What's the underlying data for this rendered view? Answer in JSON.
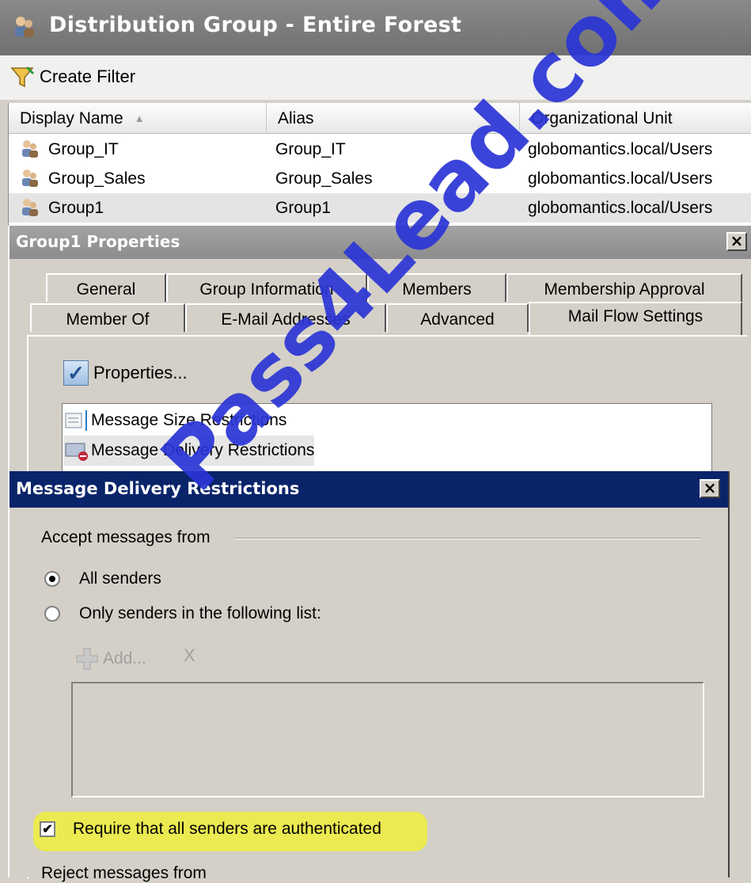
{
  "window": {
    "title": "Distribution Group - Entire Forest",
    "icon": "group-icon"
  },
  "toolbar": {
    "create_filter_label": "Create Filter",
    "icon": "filter-icon"
  },
  "grid": {
    "columns": [
      "Display Name",
      "Alias",
      "Organizational Unit"
    ],
    "sort_column": "Display Name",
    "sort_direction": "ascending",
    "rows": [
      {
        "display_name": "Group_IT",
        "alias": "Group_IT",
        "ou": "globomantics.local/Users"
      },
      {
        "display_name": "Group_Sales",
        "alias": "Group_Sales",
        "ou": "globomantics.local/Users"
      },
      {
        "display_name": "Group1",
        "alias": "Group1",
        "ou": "globomantics.local/Users"
      }
    ],
    "selected_row": "Group1"
  },
  "properties": {
    "title": "Group1 Properties",
    "close": "×",
    "tabs_row1": [
      "General",
      "Group Information",
      "Members",
      "Membership Approval"
    ],
    "tabs_row2": [
      "Member Of",
      "E-Mail Addresses",
      "Advanced",
      "Mail Flow Settings"
    ],
    "active_tab": "Mail Flow Settings",
    "properties_button": "Properties...",
    "settings_items": [
      "Message Size Restrictions",
      "Message Delivery Restrictions"
    ],
    "selected_setting": "Message Delivery Restrictions"
  },
  "mdr_dialog": {
    "title": "Message Delivery Restrictions",
    "close": "×",
    "accept_label": "Accept messages from",
    "radio_all": "All senders",
    "radio_only": "Only senders in the following list:",
    "selected_radio": "All senders",
    "add_button": "Add...",
    "remove_glyph": "X",
    "require_auth": "Require that all senders are authenticated",
    "require_auth_checked": true,
    "reject_label": "Reject messages from"
  },
  "watermark": "Pass4Lead.com",
  "colors": {
    "dialog_title": "#0a246a",
    "highlight": "#efef3c",
    "watermark": "#2b35d6"
  }
}
